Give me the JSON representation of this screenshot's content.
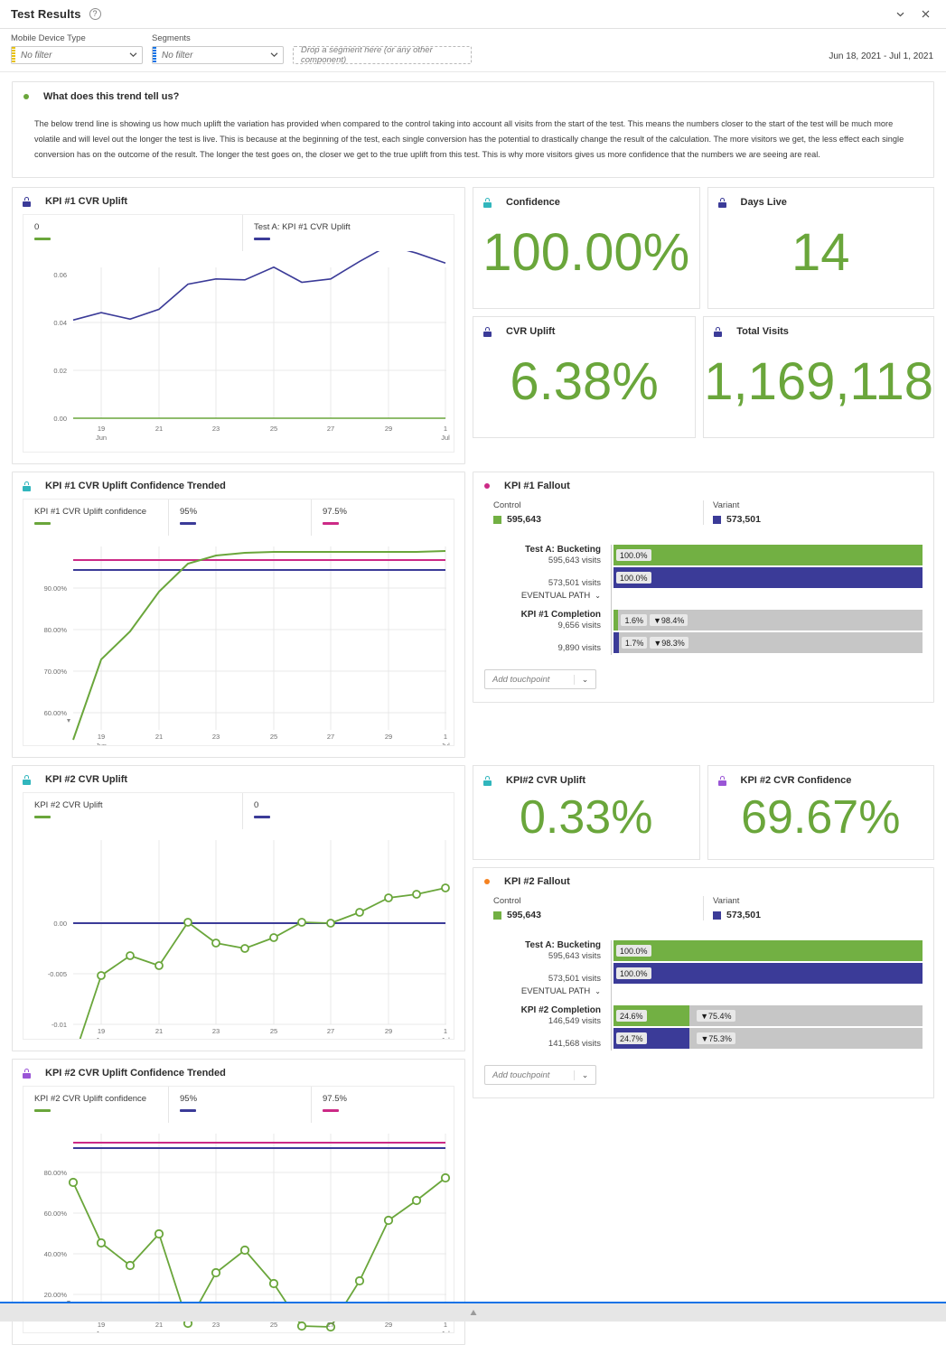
{
  "window": {
    "title": "Test Results",
    "help_icon": "question-circle-icon",
    "collapse_icon": "chevron-down-icon",
    "close_icon": "close-icon"
  },
  "filters": {
    "device": {
      "label": "Mobile Device Type",
      "value": "No filter",
      "marker_color": "#e8c20a"
    },
    "segments": {
      "label": "Segments",
      "value": "No filter",
      "marker_color": "#1473e6"
    },
    "dropzone_placeholder": "Drop a segment here (or any other component)",
    "date_range": "Jun 18, 2021 - Jul 1, 2021"
  },
  "insight": {
    "title": "What does this trend tell us?",
    "body": "The below trend line is showing us how much uplift the variation has provided when compared to the control taking into account all visits from the start of the test. This means the numbers closer to the start of the test will be much more volatile and will level out the longer the test is live. This is because at the beginning of the test, each single conversion has the potential to drastically change the result of the calculation. The more visitors we get, the less effect each single conversion has on the outcome of the result. The longer the test goes on, the closer we get to the true uplift from this test. This is why more visitors gives us more confidence that the numbers we are seeing are real."
  },
  "cards": [
    {
      "title": "Confidence",
      "value": "100.00%",
      "icon": "lock-icon",
      "icon_color": "#31b6bd"
    },
    {
      "title": "Days Live",
      "value": "14",
      "icon": "lock-icon",
      "icon_color": "#3b3b98"
    },
    {
      "title": "CVR Uplift",
      "value": "6.38%",
      "icon": "lock-icon",
      "icon_color": "#3b3b98"
    },
    {
      "title": "Total Visits",
      "value": "1,169,118",
      "icon": "lock-icon",
      "icon_color": "#3b3b98"
    },
    {
      "title": "KPI#2 CVR Uplift",
      "value": "0.33%",
      "icon": "lock-icon",
      "icon_color": "#31b6bd"
    },
    {
      "title": "KPI #2 CVR Confidence",
      "value": "69.67%",
      "icon": "lock-icon",
      "icon_color": "#9a55d6"
    }
  ],
  "panels": {
    "kpi1_uplift": {
      "title": "KPI #1 CVR Uplift",
      "icon": "lock-icon",
      "icon_color": "#3b3b98"
    },
    "kpi1_conf": {
      "title": "KPI #1 CVR Uplift Confidence Trended",
      "icon": "lock-icon",
      "icon_color": "#31b6bd"
    },
    "kpi2_uplift": {
      "title": "KPI #2 CVR Uplift",
      "icon": "lock-icon",
      "icon_color": "#31b6bd"
    },
    "kpi2_conf": {
      "title": "KPI #2 CVR Uplift Confidence Trended",
      "icon": "lock-icon",
      "icon_color": "#9a55d6"
    },
    "kpi1_fallout": {
      "title": "KPI #1 Fallout",
      "icon": "dot-icon",
      "icon_color": "#cc2a86"
    },
    "kpi2_fallout": {
      "title": "KPI #2 Fallout",
      "icon": "dot-icon",
      "icon_color": "#f58220"
    }
  },
  "fallout1": {
    "control_label": "Control",
    "control_value": "595,643",
    "variant_label": "Variant",
    "variant_value": "573,501",
    "step1_title": "Test A: Bucketing",
    "step1_control_visits": "595,643 visits",
    "step1_variant_visits": "573,501 visits",
    "step1_control_pct": "100.0%",
    "step1_variant_pct": "100.0%",
    "eventual_path": "EVENTUAL PATH",
    "step2_title": "KPI #1 Completion",
    "step2_control_visits": "9,656 visits",
    "step2_variant_visits": "9,890 visits",
    "step2_control_pct": "1.6%",
    "step2_control_drop": "▼98.4%",
    "step2_variant_pct": "1.7%",
    "step2_variant_drop": "▼98.3%",
    "add_touchpoint": "Add touchpoint"
  },
  "fallout2": {
    "control_label": "Control",
    "control_value": "595,643",
    "variant_label": "Variant",
    "variant_value": "573,501",
    "step1_title": "Test A: Bucketing",
    "step1_control_visits": "595,643 visits",
    "step1_variant_visits": "573,501 visits",
    "step1_control_pct": "100.0%",
    "step1_variant_pct": "100.0%",
    "eventual_path": "EVENTUAL PATH",
    "step2_title": "KPI #2 Completion",
    "step2_control_visits": "146,549 visits",
    "step2_variant_visits": "141,568 visits",
    "step2_control_pct": "24.6%",
    "step2_control_drop": "▼75.4%",
    "step2_variant_pct": "24.7%",
    "step2_variant_drop": "▼75.3%",
    "add_touchpoint": "Add touchpoint"
  },
  "chart_data": [
    {
      "id": "kpi1_uplift",
      "type": "line",
      "title": "KPI #1 CVR Uplift",
      "xlabel": "",
      "ylabel": "",
      "x": [
        "18 Jun",
        "19",
        "20",
        "21",
        "22",
        "23",
        "24",
        "25",
        "26",
        "27",
        "28",
        "29",
        "30",
        "1 Jul"
      ],
      "tick_labels": [
        "19",
        "21",
        "23",
        "25",
        "27",
        "29",
        "1"
      ],
      "tick_sublabels": [
        "Jun",
        "",
        "",
        "",
        "",
        "",
        "Jul"
      ],
      "ytick_labels": [
        "0.00",
        "0.02",
        "0.04",
        "0.06"
      ],
      "ylim": [
        0,
        0.08
      ],
      "grid": true,
      "legend_position": "top",
      "series": [
        {
          "name": "0",
          "color": "#6aa63b",
          "values": [
            0,
            0,
            0,
            0,
            0,
            0,
            0,
            0,
            0,
            0,
            0,
            0,
            0,
            0
          ]
        },
        {
          "name": "Test A: KPI #1 CVR Uplift",
          "color": "#3b3b98",
          "values": [
            0.041,
            0.0441,
            0.0414,
            0.0455,
            0.056,
            0.0582,
            0.0578,
            0.0631,
            0.0568,
            0.0582,
            0.0655,
            0.0722,
            0.069,
            0.0648
          ]
        }
      ]
    },
    {
      "id": "kpi1_conf",
      "type": "line",
      "title": "KPI #1 CVR Uplift Confidence Trended",
      "x": [
        "18 Jun",
        "19",
        "20",
        "21",
        "22",
        "23",
        "24",
        "25",
        "26",
        "27",
        "28",
        "29",
        "30",
        "1 Jul"
      ],
      "tick_labels": [
        "19",
        "21",
        "23",
        "25",
        "27",
        "29",
        "1"
      ],
      "tick_sublabels": [
        "Jun",
        "",
        "",
        "",
        "",
        "",
        "Jul"
      ],
      "ytick_labels": [
        "60.00%",
        "70.00%",
        "80.00%",
        "90.00%"
      ],
      "ylim": [
        53,
        100
      ],
      "grid": true,
      "legend_position": "top",
      "series": [
        {
          "name": "KPI #1 CVR Uplift confidence",
          "color": "#6aa63b",
          "values": [
            53.5,
            72.8,
            79.5,
            89.0,
            95.8,
            97.8,
            98.3,
            98.6,
            98.6,
            98.5,
            98.5,
            98.5,
            98.5,
            98.7
          ]
        },
        {
          "name": "95%",
          "color": "#3b3b98",
          "values": [
            95,
            95,
            95,
            95,
            95,
            95,
            95,
            95,
            95,
            95,
            95,
            95,
            95,
            95
          ]
        },
        {
          "name": "97.5%",
          "color": "#cc2a86",
          "values": [
            96.5,
            96.5,
            96.5,
            96.5,
            96.5,
            96.5,
            96.5,
            96.5,
            96.5,
            96.5,
            96.5,
            96.5,
            96.5,
            96.5
          ]
        }
      ]
    },
    {
      "id": "kpi2_uplift",
      "type": "line",
      "title": "KPI #2 CVR Uplift",
      "x": [
        "18 Jun",
        "19",
        "20",
        "21",
        "22",
        "23",
        "24",
        "25",
        "26",
        "27",
        "28",
        "29",
        "30",
        "1 Jul"
      ],
      "tick_labels": [
        "19",
        "21",
        "23",
        "25",
        "27",
        "29",
        "1"
      ],
      "tick_sublabels": [
        "Jun",
        "",
        "",
        "",
        "",
        "",
        "Jul"
      ],
      "ytick_labels": [
        "-0.01",
        "-0.005",
        "0.00"
      ],
      "ylim": [
        -0.0145,
        0.0045
      ],
      "grid": true,
      "markers": true,
      "legend_position": "top",
      "series": [
        {
          "name": "KPI #2 CVR Uplift",
          "color": "#6aa63b",
          "values": [
            -0.0135,
            -0.0052,
            -0.0032,
            -0.0042,
            0.0001,
            -0.002,
            -0.0025,
            -0.0014,
            0.0001,
            0.0,
            0.0011,
            0.0025,
            0.0029,
            0.0035
          ]
        },
        {
          "name": "0",
          "color": "#3b3b98",
          "values": [
            0,
            0,
            0,
            0,
            0,
            0,
            0,
            0,
            0,
            0,
            0,
            0,
            0,
            0
          ]
        }
      ]
    },
    {
      "id": "kpi2_conf",
      "type": "line",
      "title": "KPI #2 CVR Uplift Confidence Trended",
      "x": [
        "18 Jun",
        "19",
        "20",
        "21",
        "22",
        "23",
        "24",
        "25",
        "26",
        "27",
        "28",
        "29",
        "30",
        "1 Jul"
      ],
      "tick_labels": [
        "19",
        "21",
        "23",
        "25",
        "27",
        "29",
        "1"
      ],
      "tick_sublabels": [
        "Jun",
        "",
        "",
        "",
        "",
        "",
        "Jul"
      ],
      "ytick_labels": [
        "20.00%",
        "40.00%",
        "60.00%",
        "80.00%"
      ],
      "ylim": [
        0,
        100
      ],
      "grid": true,
      "markers": true,
      "legend_position": "top",
      "series": [
        {
          "name": "KPI #2 CVR Uplift confidence",
          "color": "#6aa63b",
          "values": [
            74.6,
            45.0,
            33.8,
            49.6,
            5.8,
            30.4,
            41.3,
            25.2,
            4.5,
            4.3,
            26.4,
            56.3,
            66.0,
            77.5
          ]
        },
        {
          "name": "95%",
          "color": "#3b3b98",
          "values": [
            95,
            95,
            95,
            95,
            95,
            95,
            95,
            95,
            95,
            95,
            95,
            95,
            95,
            95
          ]
        },
        {
          "name": "97.5%",
          "color": "#cc2a86",
          "values": [
            97.5,
            97.5,
            97.5,
            97.5,
            97.5,
            97.5,
            97.5,
            97.5,
            97.5,
            97.5,
            97.5,
            97.5,
            97.5,
            97.5
          ]
        }
      ]
    }
  ]
}
